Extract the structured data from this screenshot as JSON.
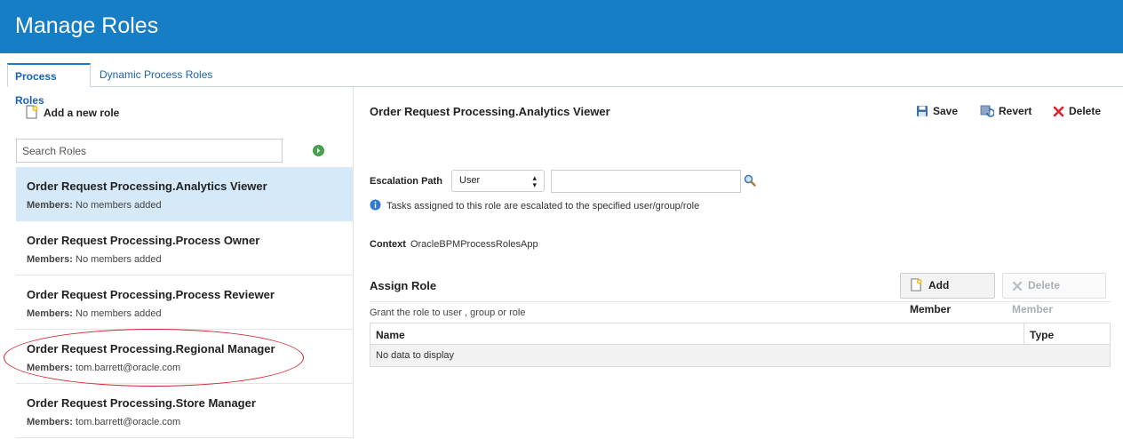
{
  "header": {
    "title": "Manage Roles",
    "bg_color": "#157ec4"
  },
  "tabs": [
    {
      "label": "Process Roles",
      "active": true
    },
    {
      "label": "Dynamic Process Roles",
      "active": false
    }
  ],
  "left": {
    "add_role_label": "Add a new role",
    "search_placeholder": "Search Roles",
    "members_label": "Members:",
    "roles": [
      {
        "name": "Order Request Processing.Analytics Viewer",
        "members": "No members added",
        "selected": true
      },
      {
        "name": "Order Request Processing.Process Owner",
        "members": "No members added",
        "selected": false
      },
      {
        "name": "Order Request Processing.Process Reviewer",
        "members": "No members added",
        "selected": false
      },
      {
        "name": "Order Request Processing.Regional Manager",
        "members": "tom.barrett@oracle.com",
        "selected": false,
        "highlighted": true
      },
      {
        "name": "Order Request Processing.Store Manager",
        "members": "tom.barrett@oracle.com",
        "selected": false
      }
    ]
  },
  "detail": {
    "title": "Order Request Processing.Analytics Viewer",
    "save_label": "Save",
    "revert_label": "Revert",
    "delete_label": "Delete",
    "escalation_label": "Escalation Path",
    "escalation_type": "User",
    "escalation_value": "",
    "escalation_info": "Tasks assigned to this role are escalated to the specified user/group/role",
    "context_label": "Context",
    "context_value": "OracleBPMProcessRolesApp",
    "assign_title": "Assign Role",
    "add_member_label": "Add Member",
    "delete_member_label": "Delete Member",
    "grant_text": "Grant the role to user , group or role",
    "table": {
      "columns": [
        "Name",
        "Type"
      ],
      "empty_text": "No data to display"
    }
  }
}
